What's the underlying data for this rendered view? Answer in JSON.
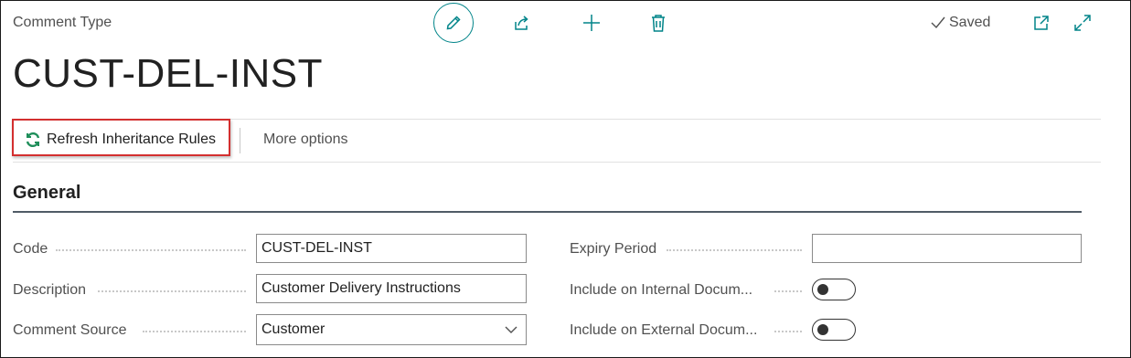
{
  "header": {
    "page_caption": "Comment Type",
    "record_title": "CUST-DEL-INST",
    "status": "Saved",
    "toolbar_icons": [
      "edit-icon",
      "share-icon",
      "new-icon",
      "delete-icon",
      "open-new-window-icon",
      "expand-icon"
    ]
  },
  "actions": {
    "refresh_label": "Refresh Inheritance Rules",
    "more_label": "More options"
  },
  "section": {
    "title": "General"
  },
  "fields": {
    "code": {
      "label": "Code",
      "value": "CUST-DEL-INST"
    },
    "description": {
      "label": "Description",
      "value": "Customer Delivery Instructions"
    },
    "comment_source": {
      "label": "Comment Source",
      "value": "Customer"
    },
    "expiry_period": {
      "label": "Expiry Period",
      "value": ""
    },
    "include_internal": {
      "label": "Include on Internal Docum...",
      "value": false
    },
    "include_external": {
      "label": "Include on External Docum...",
      "value": false
    }
  },
  "colors": {
    "accent": "#008489",
    "highlight_border": "#d32f2f",
    "refresh_icon": "#1e8e5a"
  }
}
